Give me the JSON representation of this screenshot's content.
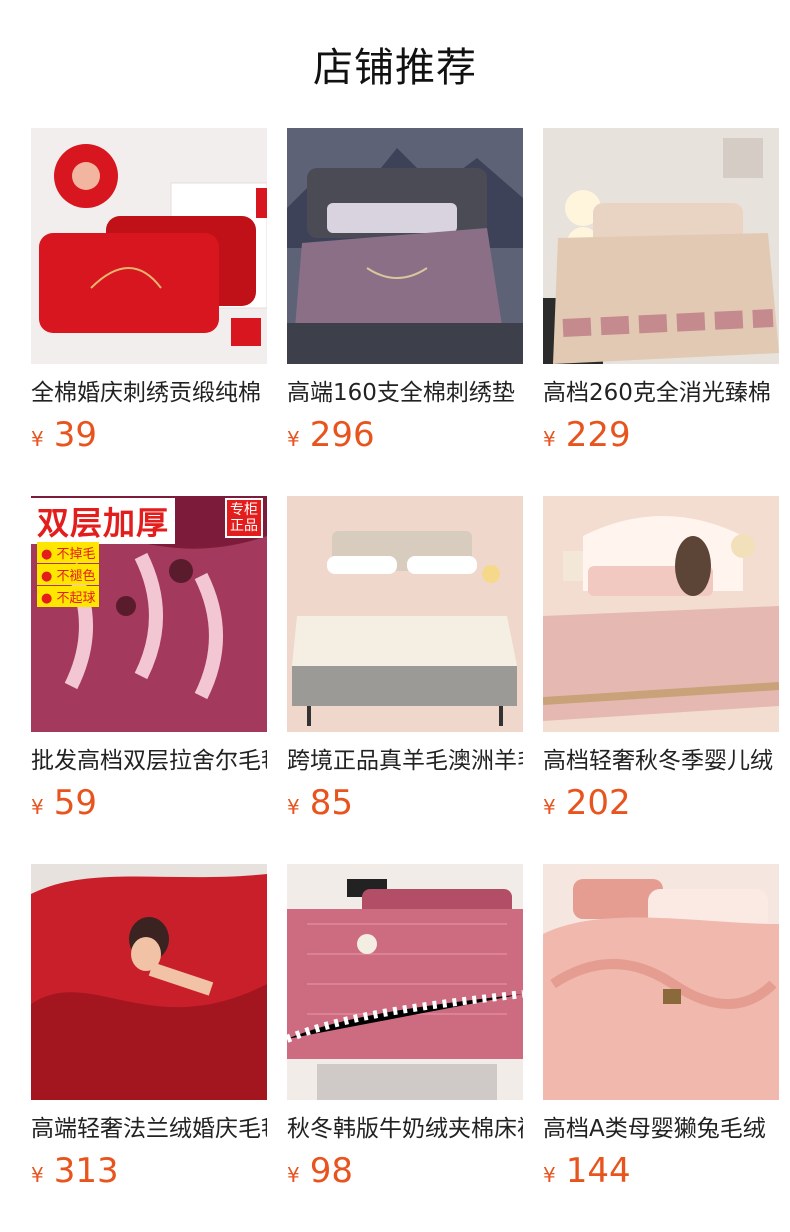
{
  "section_title": "店铺推荐",
  "products": [
    {
      "title": "全棉婚庆刺绣贡缎纯棉",
      "currency": "¥",
      "price": "39",
      "image_icon": "red-pillow-image",
      "colors": {
        "bg": "#f3eeee",
        "main": "#d8161f",
        "accent": "#c01018",
        "extra": "#ffffff"
      }
    },
    {
      "title": "高端160支全棉刺绣垫",
      "currency": "¥",
      "price": "296",
      "image_icon": "purple-bedding-image",
      "colors": {
        "bg": "#5d6276",
        "main": "#8a6f86",
        "accent": "#4b4b55",
        "extra": "#d9d3e0"
      }
    },
    {
      "title": "高档260克全消光臻棉",
      "currency": "¥",
      "price": "229",
      "image_icon": "beige-bedding-image",
      "colors": {
        "bg": "#e8e2dc",
        "main": "#e2c9b3",
        "accent": "#c58a8e",
        "extra": "#ffffff"
      }
    },
    {
      "title": "批发高档双层拉舍尔毛毯",
      "currency": "¥",
      "price": "59",
      "image_icon": "maroon-blanket-image",
      "colors": {
        "bg": "#7c1c3a",
        "main": "#a33a5e",
        "accent": "#f2c6d2",
        "extra": "#e31c1c"
      },
      "overlay": {
        "headline": "双层加厚",
        "badge_line1": "专柜",
        "badge_line2": "正品",
        "features": [
          "不掉毛",
          "不褪色",
          "不起球"
        ]
      }
    },
    {
      "title": "跨境正品真羊毛澳洲羊毛",
      "currency": "¥",
      "price": "85",
      "image_icon": "wool-mattress-image",
      "colors": {
        "bg": "#f0d7cc",
        "main": "#f4efe2",
        "accent": "#9c9a97",
        "extra": "#d9cbbd"
      }
    },
    {
      "title": "高档轻奢秋冬季婴儿绒",
      "currency": "¥",
      "price": "202",
      "image_icon": "pink-bedding-image",
      "colors": {
        "bg": "#f3ddd1",
        "main": "#e5b9b1",
        "accent": "#c9a27a",
        "extra": "#fff5ee"
      }
    },
    {
      "title": "高端轻奢法兰绒婚庆毛毯",
      "currency": "¥",
      "price": "313",
      "image_icon": "red-flannel-image",
      "colors": {
        "bg": "#e8e2de",
        "main": "#c91f2b",
        "accent": "#a3151f",
        "extra": "#f1c2a5"
      }
    },
    {
      "title": "秋冬韩版牛奶绒夹棉床裙",
      "currency": "¥",
      "price": "98",
      "image_icon": "pink-quilt-image",
      "colors": {
        "bg": "#f2ece8",
        "main": "#cd6b80",
        "accent": "#b24f66",
        "extra": "#ffffff"
      }
    },
    {
      "title": "高档A类母婴獭兔毛绒",
      "currency": "¥",
      "price": "144",
      "image_icon": "pink-plush-image",
      "colors": {
        "bg": "#f6e6e0",
        "main": "#f1b9ad",
        "accent": "#e59d91",
        "extra": "#fbe9e4"
      }
    }
  ]
}
